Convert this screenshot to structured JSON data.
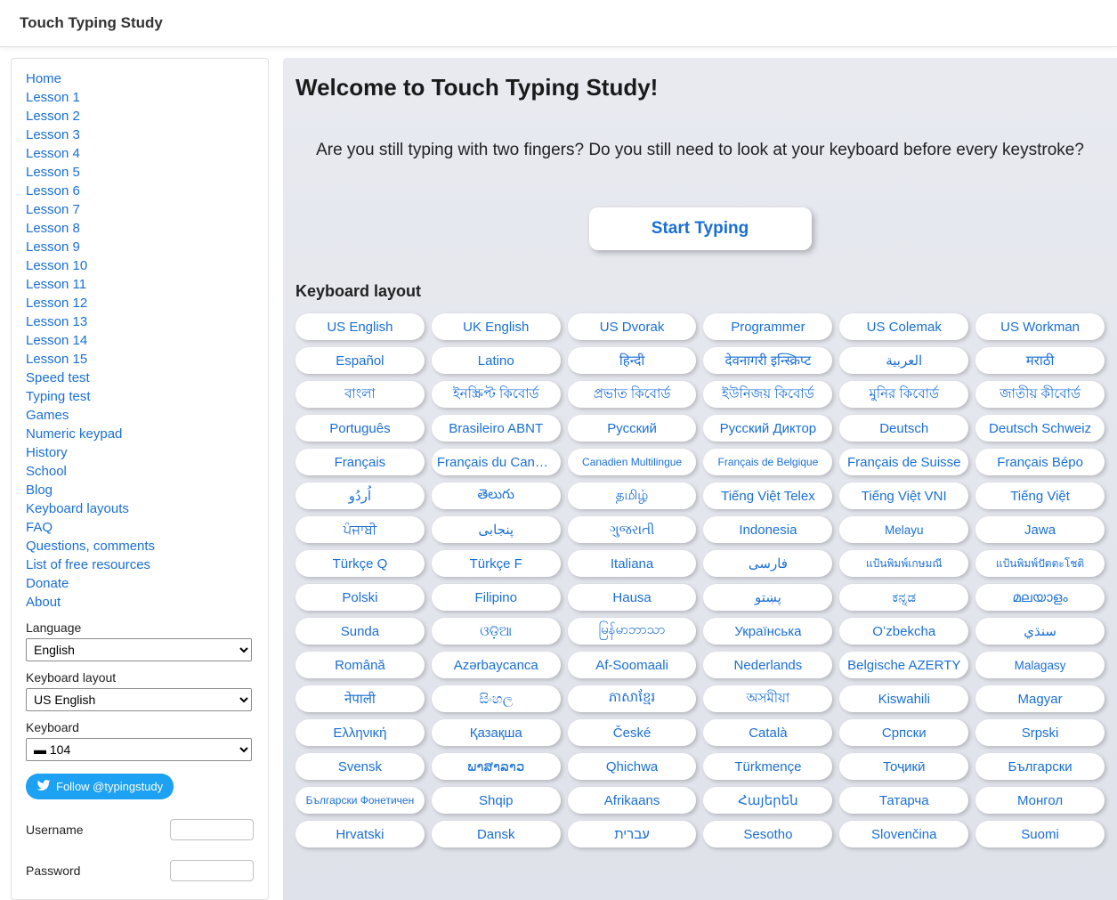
{
  "site_title": "Touch Typing Study",
  "sidebar": {
    "links": [
      "Home",
      "Lesson 1",
      "Lesson 2",
      "Lesson 3",
      "Lesson 4",
      "Lesson 5",
      "Lesson 6",
      "Lesson 7",
      "Lesson 8",
      "Lesson 9",
      "Lesson 10",
      "Lesson 11",
      "Lesson 12",
      "Lesson 13",
      "Lesson 14",
      "Lesson 15",
      "Speed test",
      "Typing test",
      "Games",
      "Numeric keypad",
      "History",
      "School",
      "Blog",
      "Keyboard layouts",
      "FAQ",
      "Questions, comments",
      "List of free resources",
      "Donate",
      "About"
    ],
    "language_label": "Language",
    "language_value": "English",
    "layout_label": "Keyboard layout",
    "layout_value": "US English",
    "keyboard_label": "Keyboard",
    "keyboard_value": "104",
    "twitter_label": "Follow @typingstudy",
    "username_label": "Username",
    "password_label": "Password"
  },
  "main": {
    "heading": "Welcome to Touch Typing Study!",
    "intro": "Are you still typing with two fingers? Do you still need to look at your keyboard before every keystroke?",
    "start_label": "Start Typing",
    "section_label": "Keyboard layout",
    "layouts": [
      "US English",
      "UK English",
      "US Dvorak",
      "Programmer",
      "US Colemak",
      "US Workman",
      "Español",
      "Latino",
      "हिन्दी",
      "देवनागरी इन्स्क्रिप्ट",
      "العربية",
      "मराठी",
      "বাংলা",
      "ইনস্ক্রিপ্ট কিবোর্ড",
      "প্রভাত কিবোর্ড",
      "ইউনিজয় কিবোর্ড",
      "মুনির কিবোর্ড",
      "জাতীয় কীবোর্ড",
      "Português",
      "Brasileiro ABNT",
      "Русский",
      "Русский Диктор",
      "Deutsch",
      "Deutsch Schweiz",
      "Français",
      "Français du Canada",
      "Canadien Multilingue",
      "Français de Belgique",
      "Français de Suisse",
      "Français Bépo",
      "اُردُو",
      "తెలుగు",
      "தமிழ்",
      "Tiếng Việt Telex",
      "Tiếng Việt VNI",
      "Tiếng Việt",
      "ਪੰਜਾਬੀ",
      "پنجابی",
      "ગુજરાતી",
      "Indonesia",
      "Melayu",
      "Jawa",
      "Türkçe Q",
      "Türkçe F",
      "Italiana",
      "فارسى",
      "แป้นพิมพ์เกษมณี",
      "แป้นพิมพ์ปัตตะโชติ",
      "Polski",
      "Filipino",
      "Hausa",
      "پښتو",
      "ಕನ್ನಡ",
      "മലയാളം",
      "Sunda",
      "ଓଡ଼ିଆ",
      "မြန်မာဘာသာ",
      "Українська",
      "Oʻzbekcha",
      "سنڌي",
      "Română",
      "Azərbaycanca",
      "Af-Soomaali",
      "Nederlands",
      "Belgische AZERTY",
      "Malagasy",
      "नेपाली",
      "සිංහල",
      "ភាសាខ្មែរ",
      "অসমীয়া",
      "Kiswahili",
      "Magyar",
      "Ελληνική",
      "Қазақша",
      "České",
      "Català",
      "Српски",
      "Srpski",
      "Svensk",
      "ພາສາລາວ",
      "Qhichwa",
      "Türkmençe",
      "Тоҷикӣ",
      "Български",
      "Български Фонетичен",
      "Shqip",
      "Afrikaans",
      "Հայերեն",
      "Татарча",
      "Монгол",
      "Hrvatski",
      "Dansk",
      "עברית",
      "Sesotho",
      "Slovenčina",
      "Suomi"
    ],
    "layout_size_hints": {
      "26": "small",
      "27": "small",
      "40": "med",
      "46": "small",
      "47": "small",
      "65": "med",
      "84": "small"
    }
  }
}
